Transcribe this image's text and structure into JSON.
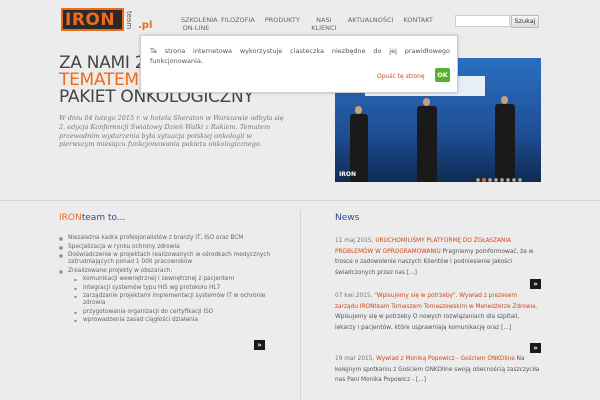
{
  "header": {
    "logo": {
      "word": "IRON",
      "team": "team",
      "tld": ".pl"
    },
    "nav": [
      {
        "label": "SZKOLENIA ON-LINE"
      },
      {
        "label": "FILOZOFIA"
      },
      {
        "label": "PRODUKTY"
      },
      {
        "label": "NASI KLIENCI"
      },
      {
        "label": "AKTUALNOŚCI"
      },
      {
        "label": "KONTAKT"
      }
    ],
    "search": {
      "value": "",
      "button": "Szukaj"
    }
  },
  "hero": {
    "line1": "ZA NAMI 2",
    "line2": "TEMATEM",
    "line3": "PAKIET ONKOLOGICZNY",
    "text": "W dniu 04 lutego 2015 r. w hotelu Sheraton w Warszawie odbyła się 2. edycja Konferencji Światowy Dzień Walki z Rakiem. Tematem przewodnim wydarzenia była sytuacja polskiej onkologii w pierwszym miesiącu funkcjonowania pakietu onkologicznego.",
    "slide_tag": "IRON",
    "slide_count": 8,
    "active_slide": 1
  },
  "iron_section": {
    "title_a": "IRON",
    "title_b": "team to...",
    "items": [
      {
        "text": "Niezależna kadra profesjonalistów z branży IT, ISO oraz BCM"
      },
      {
        "text": "Specjalizacja w rynku ochrony zdrowia"
      },
      {
        "text": "Doświadczenie w projektach realizowanych w ośrodkach medycznych zatrudniających ponad 1 000 pracowników"
      },
      {
        "text": "Zrealizowane projekty w obszarach:"
      }
    ],
    "sub_items": [
      {
        "text": "komunikacji wewnętrznej i zewnętrznej z pacjentem"
      },
      {
        "text": "integracji systemów typu HIS wg protokołu HL7"
      },
      {
        "text": "zarządzanie projektami implementacji systemów IT w ochronie zdrowia"
      },
      {
        "text": "przygotowania organizacji do certyfikacji ISO"
      },
      {
        "text": "wprowadzenia zasad ciągłości działania"
      }
    ],
    "more": "»"
  },
  "news": {
    "title": "News",
    "items": [
      {
        "date": "11 maj 2015,",
        "link": "URUCHOMILIŚMY PLATFORMĘ DO ZGŁASZANIA PROBLEMÓW W OPROGRAMOWANIU",
        "text": "Pragniemy poinformować, że w trosce o zadowolenie naszych Klientów i podniesienie jakości świadczonych przez nas [...]"
      },
      {
        "date": "07 kwi 2015,",
        "link": "\"Wpisujemy się w potrzeby\". Wywiad z prezesem zarządu IRONteam Tomaszem Tomaszewskim w Menedżerze Zdrowia.",
        "text": "Wpisujemy się w potrzeby O nowych rozwiązaniach dla szpitali, lekarzy i pacjentów, które usprawniają komunikację oraz [...]"
      },
      {
        "date": "19 mar 2015,",
        "link": "Wywiad z Moniką Popowicz - Gościem ONKOline",
        "text": "Na kolejnym spotkaniu z Gościem ONKOline swoją obecnością zaszczyciła nas Pani Monika Popowicz - [...]"
      }
    ],
    "more": "»"
  },
  "cookie": {
    "text": "Ta strona internetowa wykorzystuje ciasteczka niezbędne do jej prawidłowego funkcjonowania.",
    "link": "Opuść tę stronę",
    "ok": "OK"
  },
  "colors": {
    "accent": "#ee6a1c",
    "link": "#d4461a",
    "heading_blue": "#2a4f8a",
    "ok_green": "#55b130"
  }
}
